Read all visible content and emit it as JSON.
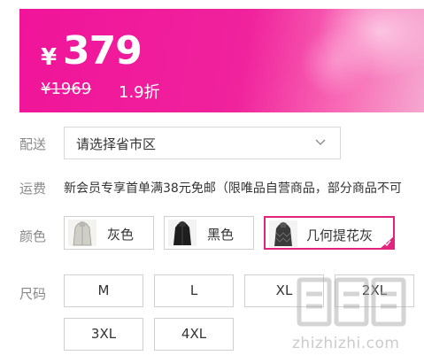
{
  "price": {
    "currency": "¥",
    "amount": "379",
    "original": "¥1969",
    "discount": "1.9折"
  },
  "delivery": {
    "label": "配送",
    "placeholder": "请选择省市区"
  },
  "shipping": {
    "label": "运费",
    "text": "新会员专享首单满38元免邮（限唯品自营商品，部分商品不可"
  },
  "color": {
    "label": "颜色",
    "options": [
      {
        "label": "灰色",
        "selected": false,
        "thumb_color": "#cfcfc8"
      },
      {
        "label": "黑色",
        "selected": false,
        "thumb_color": "#1e1e1e"
      },
      {
        "label": "几何提花灰",
        "selected": true,
        "thumb_color": "#3a3a3a"
      }
    ],
    "accent": "#e2247e"
  },
  "size": {
    "label": "尺码",
    "options": [
      "M",
      "L",
      "XL",
      "2XL",
      "3XL",
      "4XL"
    ]
  },
  "watermark": {
    "text": "zhizhizhi.com"
  }
}
